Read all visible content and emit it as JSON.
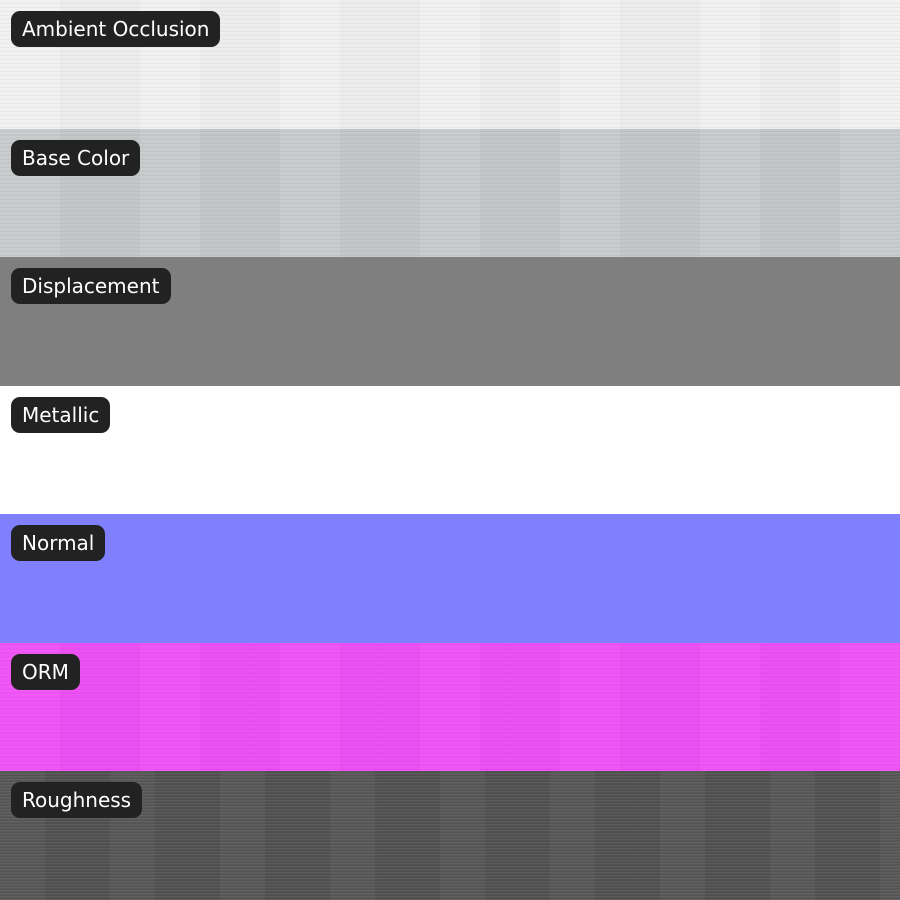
{
  "swatches": [
    {
      "label": "Ambient Occlusion",
      "color": "#f1f1f1",
      "texture": "brushed"
    },
    {
      "label": "Base Color",
      "color": "#c6c9ca",
      "texture": "brushed"
    },
    {
      "label": "Displacement",
      "color": "#7f7f7f",
      "texture": "none"
    },
    {
      "label": "Metallic",
      "color": "#ffffff",
      "texture": "none"
    },
    {
      "label": "Normal",
      "color": "#8080ff",
      "texture": "none"
    },
    {
      "label": "ORM",
      "color": "#f04ff7",
      "texture": "brushed"
    },
    {
      "label": "Roughness",
      "color": "#555555",
      "texture": "brushed-dark"
    }
  ]
}
